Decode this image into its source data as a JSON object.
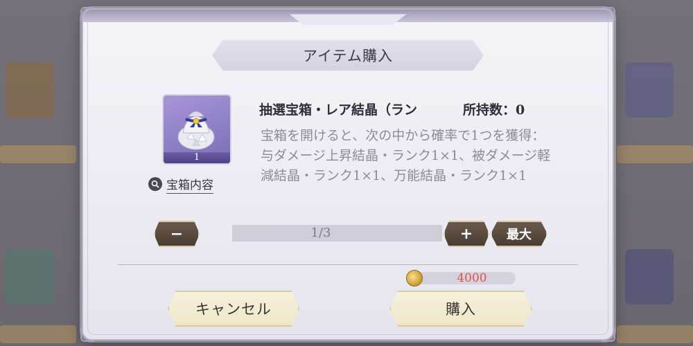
{
  "dialog": {
    "title": "アイテム購入",
    "item": {
      "name": "抽選宝箱・レア結晶（ラン",
      "owned_label": "所持数：0",
      "quantity_badge": "1",
      "description": "宝箱を開けると、次の中から確率で1つを獲得：与ダメージ上昇結晶・ランク1×1、被ダメージ軽減結晶・ランク1×1、万能結晶・ランク1×1",
      "contents_link": "宝箱内容"
    },
    "quantity": {
      "minus_label": "−",
      "plus_label": "+",
      "max_label": "最大",
      "display": "1/3",
      "current": 1,
      "max": 3
    },
    "price": {
      "value": "4000",
      "currency_icon": "gold-coin-icon",
      "color": "#e0524f"
    },
    "buttons": {
      "cancel": "キャンセル",
      "buy": "購入"
    }
  },
  "colors": {
    "accent_button_dark": "#4a3d33",
    "gold": "#c99a2c",
    "item_bg": "#8f7fc7"
  }
}
